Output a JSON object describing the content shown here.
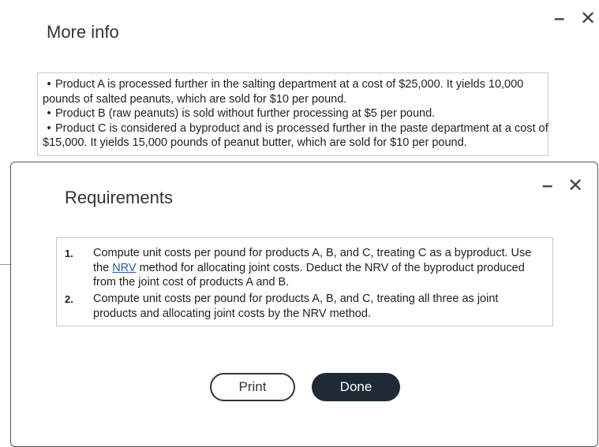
{
  "more_info": {
    "title": "More info",
    "minimize_glyph": "–",
    "close_glyph": "✕",
    "bullet": "•",
    "lines": [
      "Product A is processed further in the salting department at a cost of $25,000. It yields 10,000",
      "pounds of salted peanuts, which are sold for $10 per pound.",
      "Product B (raw peanuts) is sold without further processing at $5 per pound.",
      "Product C is considered a byproduct and is processed further in the paste department at a cost of",
      "$15,000. It yields 15,000 pounds of peanut butter,  which are sold for $10 per pound."
    ]
  },
  "requirements": {
    "title": "Requirements",
    "minimize_glyph": "–",
    "close_glyph": "✕",
    "items": [
      {
        "number": "1.",
        "line1": "Compute unit costs per pound for products A, B, and C, treating C as a byproduct. Use",
        "line2_before": "the ",
        "line2_link": "NRV",
        "line2_after": " method for allocating joint costs. Deduct the NRV of the byproduct produced",
        "line3": "from the joint cost of products A and B."
      },
      {
        "number": "2.",
        "line1": "Compute unit costs per pound for products A, B, and C, treating all three as joint",
        "line2": "products and allocating joint costs by the NRV method."
      }
    ],
    "print_label": "Print",
    "done_label": "Done"
  }
}
